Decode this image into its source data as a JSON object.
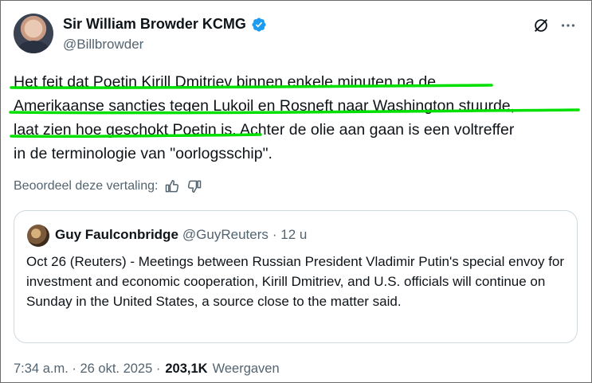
{
  "tweet": {
    "author_name": "Sir William Browder KCMG",
    "handle": "@Billbrowder",
    "body": {
      "line1": "Het feit dat Poetin Kirill Dmitriev binnen enkele minuten na de",
      "line2": "Amerikaanse sancties tegen Lukoil en Rosneft naar Washington stuurde,",
      "line3_hl": "laat zien hoe geschokt Poetin is",
      "line3_rest": ". Achter de olie aan gaan is een voltreffer",
      "line4": "in de terminologie van \"oorlogsschip\"."
    },
    "rate_translation": "Beoordeel deze vertaling:",
    "timestamp": "7:34 a.m. · 26 okt. 2025 ·",
    "views_count": "203,1K",
    "views_label": "Weergaven"
  },
  "quote": {
    "author_name": "Guy Faulconbridge",
    "handle": "@GuyReuters",
    "time": "· 12 u",
    "text": "Oct 26 (Reuters) - Meetings between Russian President Vladimir Putin's special envoy for investment and economic cooperation, Kirill Dmitriev, and U.S. officials will continue on Sunday in the United States, a source close to the matter said."
  },
  "colors": {
    "highlight_underline": "#00e000",
    "verified_badge": "#1d9bf0",
    "secondary_text": "#536471"
  },
  "icons": [
    "verified-badge-icon",
    "grok-icon",
    "more-icon",
    "thumbs-up-icon",
    "thumbs-down-icon"
  ]
}
